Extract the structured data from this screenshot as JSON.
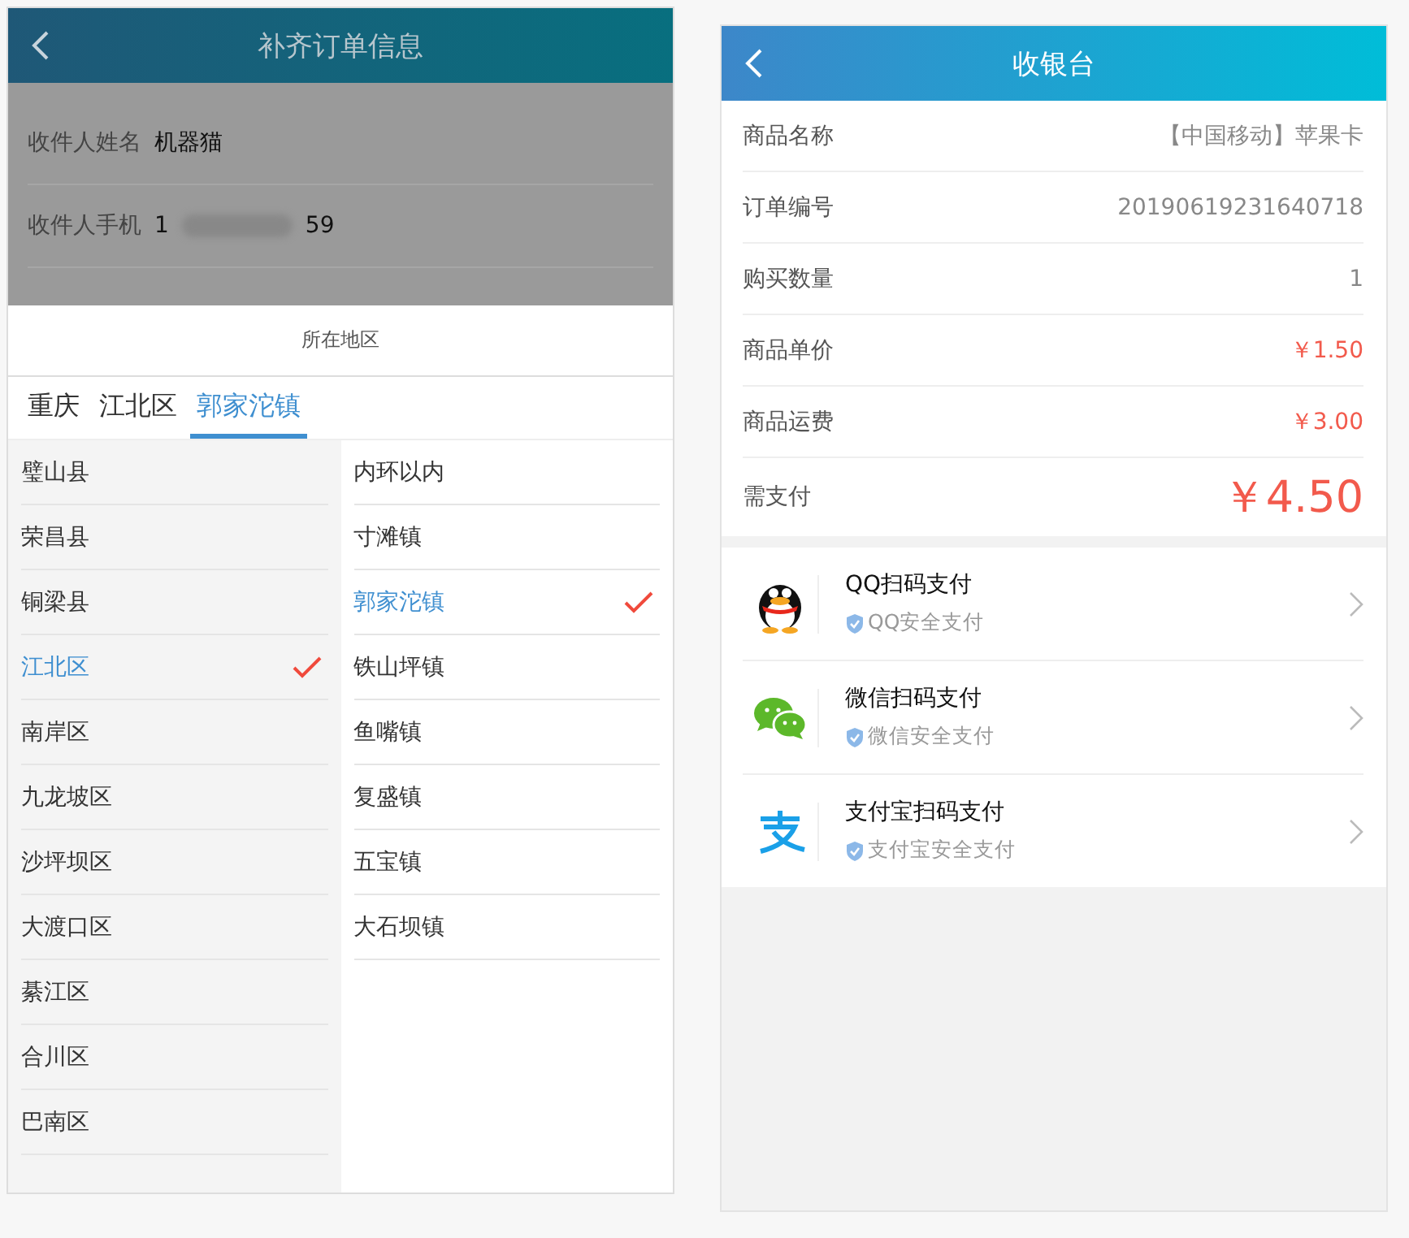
{
  "left": {
    "title": "补齐订单信息",
    "form": [
      {
        "label": "收件人姓名",
        "value": "机器猫",
        "kind": "text"
      },
      {
        "label": "收件人手机",
        "prefix": "1",
        "suffix": "59",
        "kind": "masked"
      }
    ],
    "sheet": {
      "title": "所在地区",
      "tabs": [
        {
          "label": "重庆",
          "selected": false
        },
        {
          "label": "江北区",
          "selected": false
        },
        {
          "label": "郭家沱镇",
          "selected": true
        }
      ],
      "districts": [
        {
          "label": "璧山县",
          "selected": false
        },
        {
          "label": "荣昌县",
          "selected": false
        },
        {
          "label": "铜梁县",
          "selected": false
        },
        {
          "label": "江北区",
          "selected": true
        },
        {
          "label": "南岸区",
          "selected": false
        },
        {
          "label": "九龙坡区",
          "selected": false
        },
        {
          "label": "沙坪坝区",
          "selected": false
        },
        {
          "label": "大渡口区",
          "selected": false
        },
        {
          "label": "綦江区",
          "selected": false
        },
        {
          "label": "合川区",
          "selected": false
        },
        {
          "label": "巴南区",
          "selected": false
        }
      ],
      "towns": [
        {
          "label": "内环以内",
          "selected": false
        },
        {
          "label": "寸滩镇",
          "selected": false
        },
        {
          "label": "郭家沱镇",
          "selected": true
        },
        {
          "label": "铁山坪镇",
          "selected": false
        },
        {
          "label": "鱼嘴镇",
          "selected": false
        },
        {
          "label": "复盛镇",
          "selected": false
        },
        {
          "label": "五宝镇",
          "selected": false
        },
        {
          "label": "大石坝镇",
          "selected": false
        }
      ]
    }
  },
  "right": {
    "title": "收银台",
    "rows": [
      {
        "label": "商品名称",
        "value": "【中国移动】苹果卡",
        "kind": "plain"
      },
      {
        "label": "订单编号",
        "value": "20190619231640718",
        "kind": "plain"
      },
      {
        "label": "购买数量",
        "value": "1",
        "kind": "plain"
      },
      {
        "label": "商品单价",
        "value": "￥1.50",
        "kind": "price"
      },
      {
        "label": "商品运费",
        "value": "￥3.00",
        "kind": "price"
      },
      {
        "label": "需支付",
        "value": "￥4.50",
        "kind": "total"
      }
    ],
    "payments": [
      {
        "name": "QQ扫码支付",
        "note": "QQ安全支付",
        "kind": "qq"
      },
      {
        "name": "微信扫码支付",
        "note": "微信安全支付",
        "kind": "wechat"
      },
      {
        "name": "支付宝扫码支付",
        "note": "支付宝安全支付",
        "kind": "alipay"
      }
    ]
  }
}
